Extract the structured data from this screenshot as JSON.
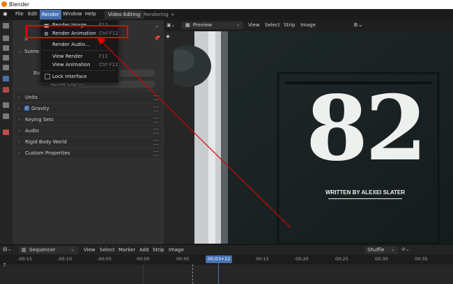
{
  "window": {
    "title": "Blender"
  },
  "menubar": {
    "items": [
      "File",
      "Edit",
      "Render",
      "Window",
      "Help"
    ],
    "active": "Render",
    "workspaces": [
      "Video Editing",
      "Rendering"
    ],
    "add_workspace": "+"
  },
  "render_menu": {
    "items": [
      {
        "label": "Render Image",
        "shortcut": "F12"
      },
      {
        "label": "Render Animation",
        "shortcut": "Ctrl F12"
      },
      {
        "label": "Render Audio...",
        "shortcut": ""
      },
      {
        "label": "View Render",
        "shortcut": "F11"
      },
      {
        "label": "View Animation",
        "shortcut": "Ctrl F11"
      },
      {
        "label": "Lock Interface",
        "shortcut": ""
      }
    ]
  },
  "properties": {
    "scene_header": "Scene",
    "bg_label_partial": "Ba",
    "active_clip_label": "Active Clip",
    "sections": [
      "Units",
      "Gravity",
      "Keying Sets",
      "Audio",
      "Rigid Body World",
      "Custom Properties"
    ],
    "gravity_checked": true
  },
  "sequencer_header": {
    "mode": "Preview",
    "menus": [
      "View",
      "Select",
      "Strip",
      "Image"
    ]
  },
  "preview": {
    "big_number": "82",
    "credit": "WRITTEN BY ALEXEI SLATER"
  },
  "timeline": {
    "editor": "Sequencer",
    "menus": [
      "View",
      "Select",
      "Marker",
      "Add",
      "Strip",
      "Image"
    ],
    "shuffle": "Shuffle",
    "ticks": [
      "-00:15",
      "-00:10",
      "-00:05",
      "00:00",
      "00:05",
      "00:09+12",
      "00:15",
      "00:20",
      "00:25",
      "00:30",
      "00:35"
    ],
    "current_frame": "00:09+12",
    "channel": "7"
  },
  "colors": {
    "accent": "#4772b3",
    "highlight_box": "#ee0000",
    "arrow": "#e00000"
  }
}
